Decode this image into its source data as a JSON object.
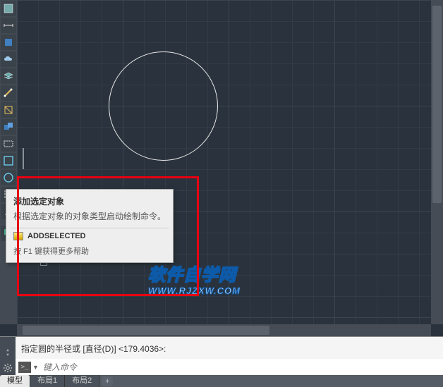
{
  "toolbar": {
    "icons": [
      "hatch",
      "dimension",
      "block",
      "cloud",
      "layer",
      "measure-dist",
      "measure-area",
      "group",
      "rectangle",
      "rect-select",
      "circle-select",
      "text-a",
      "properties",
      "add-selected"
    ]
  },
  "tooltip": {
    "title": "添加选定对象",
    "desc": "根据选定对象的对象类型启动绘制命令。",
    "command": "ADDSELECTED",
    "help": "按 F1 键获得更多帮助"
  },
  "watermark": {
    "text": "软件自学网",
    "url": "WWW.RJZXW.COM"
  },
  "command": {
    "history": "指定圆的半径或 [直径(D)] <179.4036>:",
    "placeholder": "键入命令"
  },
  "tabs": {
    "items": [
      "模型",
      "布局1",
      "布局2"
    ],
    "active_index": 0,
    "add": "+"
  },
  "ucs": {
    "x_label": "✕"
  }
}
